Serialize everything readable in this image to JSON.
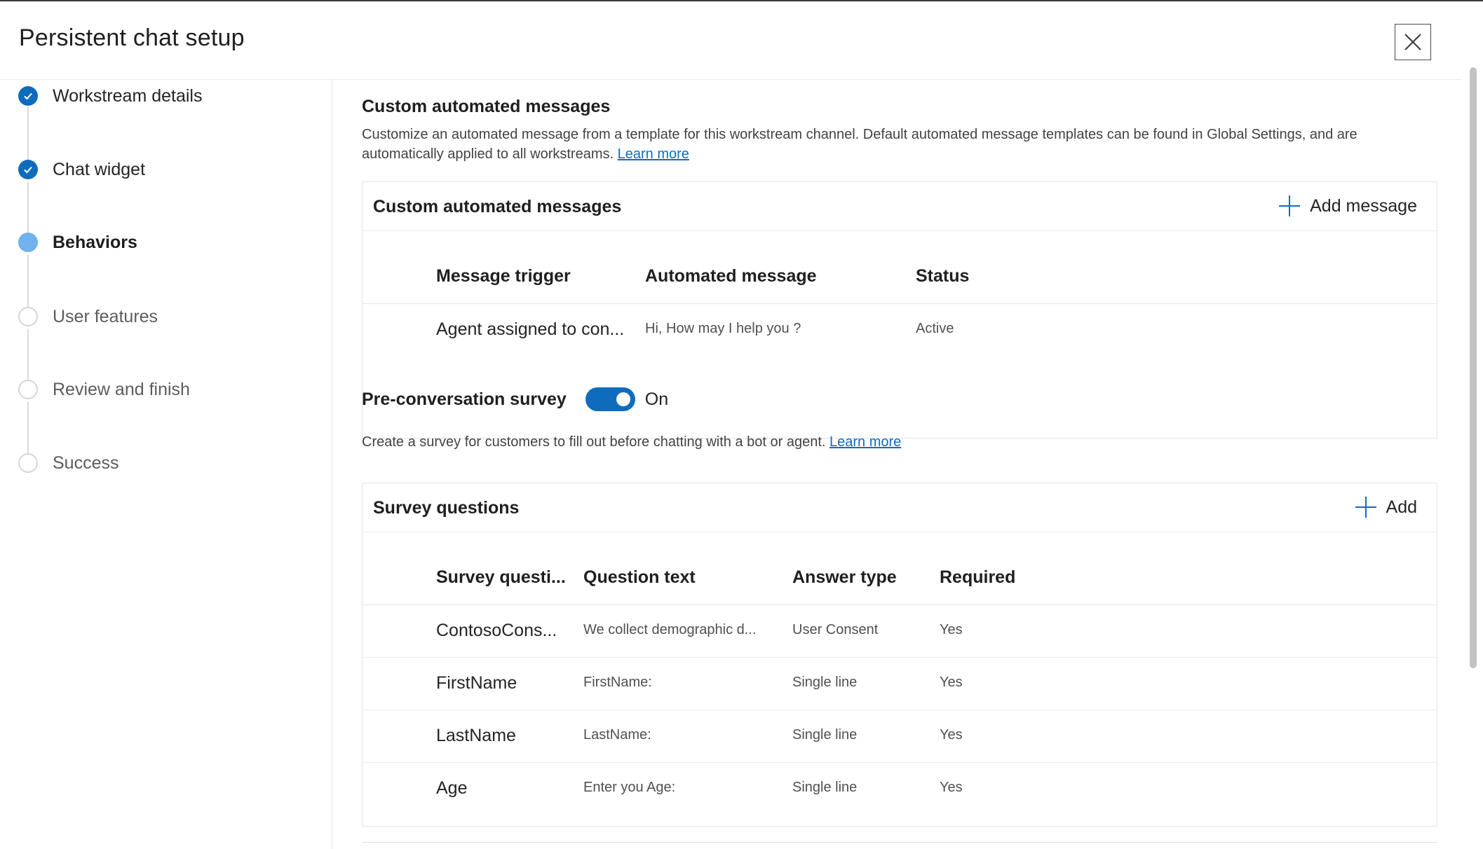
{
  "header": {
    "title": "Persistent chat setup",
    "close_icon": "close-icon"
  },
  "steps": [
    {
      "label": "Workstream details",
      "state": "done"
    },
    {
      "label": "Chat widget",
      "state": "done"
    },
    {
      "label": "Behaviors",
      "state": "current"
    },
    {
      "label": "User features",
      "state": "todo"
    },
    {
      "label": "Review and finish",
      "state": "todo"
    },
    {
      "label": "Success",
      "state": "todo"
    }
  ],
  "custom_messages": {
    "section_title": "Custom automated messages",
    "description_line1": "Customize an automated message from a template for this workstream channel. Default automated message templates can be found in Global Settings, and are",
    "description_line2": "automatically applied to all workstreams.",
    "learn_more": "Learn more",
    "card_title": "Custom automated messages",
    "add_label": "Add message",
    "columns": [
      "Message trigger",
      "Automated message",
      "Status"
    ],
    "rows": [
      {
        "trigger": "Agent assigned to con...",
        "message": "Hi, How may I help you ?",
        "status": "Active"
      }
    ]
  },
  "survey": {
    "toggle_title": "Pre-conversation survey",
    "toggle_state": "On",
    "toggle_on": true,
    "description": "Create a survey for customers to fill out before chatting with a bot or agent.",
    "learn_more": "Learn more",
    "card_title": "Survey questions",
    "add_label": "Add",
    "columns": [
      "Survey questi...",
      "Question text",
      "Answer type",
      "Required"
    ],
    "rows": [
      {
        "name": "ContosoCons...",
        "text": "We collect demographic d...",
        "type": "User Consent",
        "required": "Yes"
      },
      {
        "name": "FirstName",
        "text": "FirstName:",
        "type": "Single line",
        "required": "Yes"
      },
      {
        "name": "LastName",
        "text": "LastName:",
        "type": "Single line",
        "required": "Yes"
      },
      {
        "name": "Age",
        "text": "Enter you Age:",
        "type": "Single line",
        "required": "Yes"
      }
    ]
  },
  "colors": {
    "accent": "#0f6cbd",
    "current_step": "#70b1ee"
  }
}
